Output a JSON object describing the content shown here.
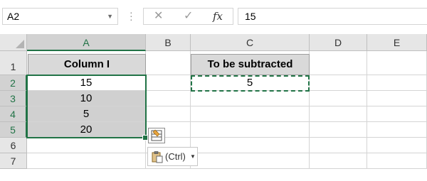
{
  "formula_bar": {
    "name_box": "A2",
    "cancel_glyph": "✕",
    "enter_glyph": "✓",
    "fx_label": "fx",
    "formula_value": "15"
  },
  "columns": [
    "A",
    "B",
    "C",
    "D",
    "E"
  ],
  "rows": [
    "1",
    "2",
    "3",
    "4",
    "5",
    "6",
    "7"
  ],
  "cells": {
    "A1": "Column I",
    "A2": "15",
    "A3": "10",
    "A4": "5",
    "A5": "20",
    "C1": "To be subtracted",
    "C2": "5"
  },
  "paste_options": {
    "label": "(Ctrl)",
    "arrow": "▼"
  },
  "colors": {
    "accent": "#217346",
    "header_fill": "#d9d9d9",
    "selected_fill": "#d0d0d0"
  },
  "icons": {
    "name_box_dropdown": "chevron-down-icon",
    "cancel": "close-icon",
    "enter": "check-icon",
    "insert_function": "fx-icon",
    "quick_analysis": "quick-analysis-icon",
    "paste_options": "clipboard-icon"
  }
}
